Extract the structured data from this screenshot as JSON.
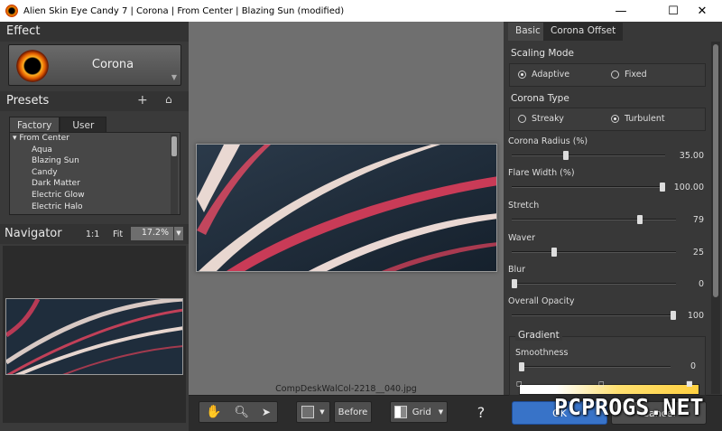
{
  "window": {
    "title": "Alien Skin Eye Candy 7 | Corona | From Center | Blazing Sun (modified)",
    "minimize": "—",
    "maximize": "☐",
    "close": "✕"
  },
  "effect": {
    "heading": "Effect",
    "name": "Corona"
  },
  "presets": {
    "heading": "Presets",
    "tabs": [
      "Factory",
      "User"
    ],
    "group": "From Center",
    "items": [
      "Aqua",
      "Blazing Sun",
      "Candy",
      "Dark Matter",
      "Electric Glow",
      "Electric Halo"
    ]
  },
  "navigator": {
    "heading": "Navigator",
    "one_to_one": "1:1",
    "fit": "Fit",
    "zoom": "17.2%"
  },
  "preview": {
    "filename": "CompDeskWalCol-2218__040.jpg"
  },
  "toolbar": {
    "before": "Before",
    "grid": "Grid"
  },
  "right": {
    "tabs": [
      "Basic",
      "Corona Offset"
    ],
    "scaling_mode": {
      "label": "Scaling Mode",
      "options": [
        "Adaptive",
        "Fixed"
      ],
      "selected": "Adaptive"
    },
    "corona_type": {
      "label": "Corona Type",
      "options": [
        "Streaky",
        "Turbulent"
      ],
      "selected": "Turbulent"
    },
    "sliders": [
      {
        "label": "Corona Radius (%)",
        "value": "35.00",
        "fraction": 0.35
      },
      {
        "label": "Flare Width (%)",
        "value": "100.00",
        "fraction": 1.0
      },
      {
        "label": "Stretch",
        "value": "79",
        "fraction": 0.79
      },
      {
        "label": "Waver",
        "value": "25",
        "fraction": 0.25
      },
      {
        "label": "Blur",
        "value": "0",
        "fraction": 0.0
      },
      {
        "label": "Overall Opacity",
        "value": "100",
        "fraction": 1.0
      }
    ],
    "gradient": {
      "label": "Gradient",
      "smoothness_label": "Smoothness",
      "smoothness_value": "0",
      "smoothness_fraction": 0.0
    }
  },
  "buttons": {
    "ok": "OK",
    "cancel": "Cancel"
  },
  "watermark": "PCPROGS.NET"
}
